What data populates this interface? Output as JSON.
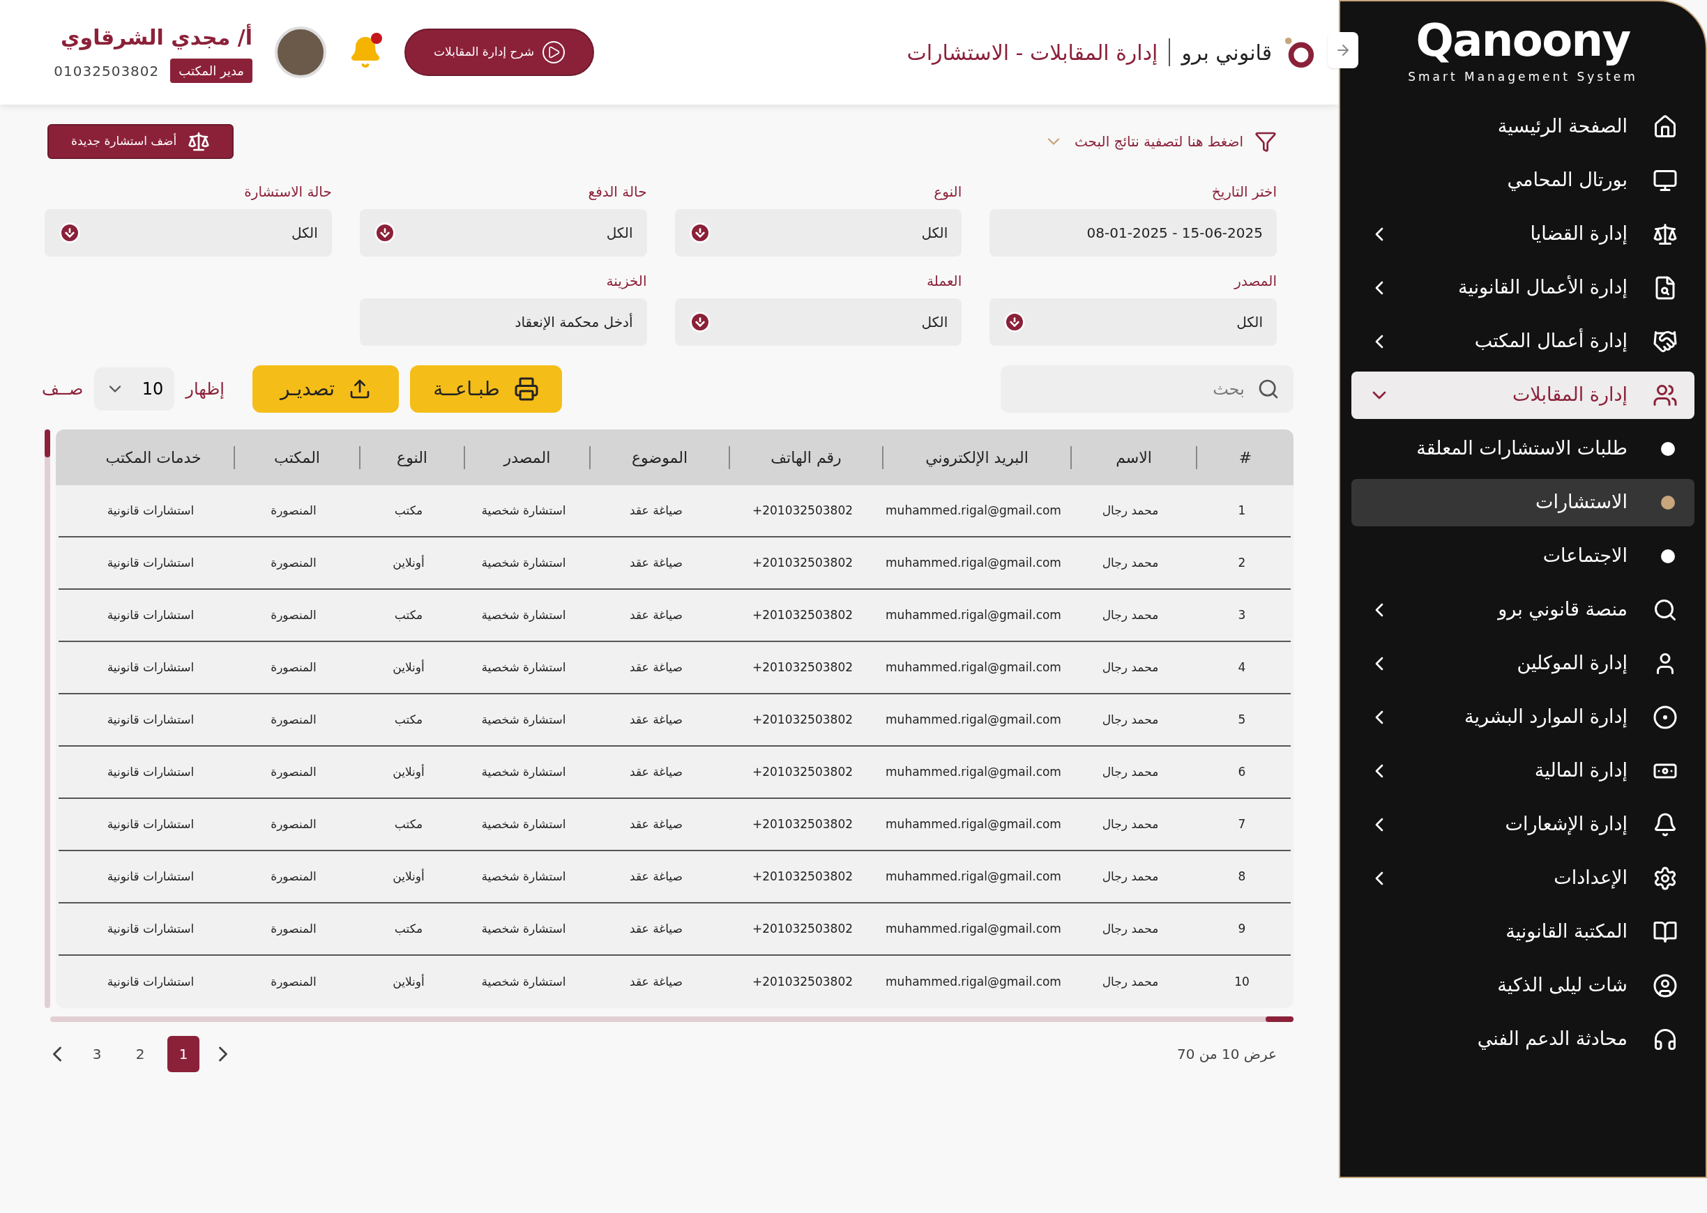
{
  "header": {
    "brand": "قانوني برو",
    "title": "إدارة المقابلات - الاستشارات",
    "guide_button": "شرح إدارة المقابلات",
    "notifications": {
      "unread": true
    },
    "user": {
      "name": "أ/ مجدي الشرقاوي",
      "role": "مدير المكتب",
      "phone": "01032503802"
    }
  },
  "filter_toggle": {
    "label": "اضغط هنا لتصفية نتائج البحث",
    "expanded": false
  },
  "add_button": "أضف استشارة جديدة",
  "filters": [
    {
      "kind": "date",
      "label": "اختر التاريخ",
      "value": "08-01-2025 - 15-06-2025"
    },
    {
      "kind": "select",
      "label": "النوع",
      "value": "الكل"
    },
    {
      "kind": "select",
      "label": "حالة الدفع",
      "value": "الكل"
    },
    {
      "kind": "select",
      "label": "حالة الاستشارة",
      "value": "الكل"
    },
    {
      "kind": "select",
      "label": "المصدر",
      "value": "الكل"
    },
    {
      "kind": "select",
      "label": "العملة",
      "value": "الكل"
    },
    {
      "kind": "text",
      "label": "الخزينة",
      "value": "أدخل محكمة الإنعقاد"
    }
  ],
  "toolbar": {
    "search_placeholder": "بحث",
    "print": "طبـاعــة",
    "export": "تصديـر",
    "show_label": "إظهار",
    "page_size": "10",
    "rows_label": "صــف"
  },
  "table": {
    "columns": [
      "#",
      "الاسم",
      "البريد الإلكتروني",
      "رقم الهاتف",
      "الموضوع",
      "المصدر",
      "النوع",
      "المكتب",
      "خدمات المكتب"
    ],
    "rows": [
      [
        "1",
        "محمد رجال",
        "muhammed.rigal@gmail.com",
        "+201032503802",
        "صياغة عقد",
        "استشارة شخصية",
        "مكتب",
        "المنصورة",
        "استشارات قانونية"
      ],
      [
        "2",
        "محمد رجال",
        "muhammed.rigal@gmail.com",
        "+201032503802",
        "صياغة عقد",
        "استشارة شخصية",
        "أونلاين",
        "المنصورة",
        "استشارات قانونية"
      ],
      [
        "3",
        "محمد رجال",
        "muhammed.rigal@gmail.com",
        "+201032503802",
        "صياغة عقد",
        "استشارة شخصية",
        "مكتب",
        "المنصورة",
        "استشارات قانونية"
      ],
      [
        "4",
        "محمد رجال",
        "muhammed.rigal@gmail.com",
        "+201032503802",
        "صياغة عقد",
        "استشارة شخصية",
        "أونلاين",
        "المنصورة",
        "استشارات قانونية"
      ],
      [
        "5",
        "محمد رجال",
        "muhammed.rigal@gmail.com",
        "+201032503802",
        "صياغة عقد",
        "استشارة شخصية",
        "مكتب",
        "المنصورة",
        "استشارات قانونية"
      ],
      [
        "6",
        "محمد رجال",
        "muhammed.rigal@gmail.com",
        "+201032503802",
        "صياغة عقد",
        "استشارة شخصية",
        "أونلاين",
        "المنصورة",
        "استشارات قانونية"
      ],
      [
        "7",
        "محمد رجال",
        "muhammed.rigal@gmail.com",
        "+201032503802",
        "صياغة عقد",
        "استشارة شخصية",
        "مكتب",
        "المنصورة",
        "استشارات قانونية"
      ],
      [
        "8",
        "محمد رجال",
        "muhammed.rigal@gmail.com",
        "+201032503802",
        "صياغة عقد",
        "استشارة شخصية",
        "أونلاين",
        "المنصورة",
        "استشارات قانونية"
      ],
      [
        "9",
        "محمد رجال",
        "muhammed.rigal@gmail.com",
        "+201032503802",
        "صياغة عقد",
        "استشارة شخصية",
        "مكتب",
        "المنصورة",
        "استشارات قانونية"
      ],
      [
        "10",
        "محمد رجال",
        "muhammed.rigal@gmail.com",
        "+201032503802",
        "صياغة عقد",
        "استشارة شخصية",
        "أونلاين",
        "المنصورة",
        "استشارات قانونية"
      ]
    ]
  },
  "pagination": {
    "summary": "عرض 10 من 70",
    "pages": [
      {
        "label": "1",
        "selected": true
      },
      {
        "label": "2",
        "selected": false
      },
      {
        "label": "3",
        "selected": false
      }
    ]
  },
  "sidebar": {
    "logo": "Qanoony",
    "tagline": "Smart Management System",
    "items": [
      {
        "label": "الصفحة الرئيسية",
        "has_submenu": false,
        "selected": false
      },
      {
        "label": "بورتال المحامي",
        "has_submenu": false,
        "selected": false
      },
      {
        "label": "إدارة القضايا",
        "has_submenu": true,
        "selected": false,
        "expanded": false
      },
      {
        "label": "إدارة الأعمال القانونية",
        "has_submenu": true,
        "selected": false,
        "expanded": false
      },
      {
        "label": "إدارة أعمال المكتب",
        "has_submenu": true,
        "selected": false,
        "expanded": false
      },
      {
        "label": "إدارة المقابلات",
        "has_submenu": true,
        "selected": true,
        "expanded": true,
        "children": [
          {
            "label": "طلبات الاستشارات المعلقة",
            "selected": false
          },
          {
            "label": "الاستشارات",
            "selected": true
          },
          {
            "label": "الاجتماعات",
            "selected": false
          }
        ]
      },
      {
        "label": "منصة قانوني برو",
        "has_submenu": true,
        "selected": false,
        "expanded": false
      },
      {
        "label": "إدارة الموكلين",
        "has_submenu": true,
        "selected": false,
        "expanded": false
      },
      {
        "label": "إدارة الموارد البشرية",
        "has_submenu": true,
        "selected": false,
        "expanded": false
      },
      {
        "label": "إدارة المالية",
        "has_submenu": true,
        "selected": false,
        "expanded": false
      },
      {
        "label": "إدارة الإشعارات",
        "has_submenu": true,
        "selected": false,
        "expanded": false
      },
      {
        "label": "الإعدادات",
        "has_submenu": true,
        "selected": false,
        "expanded": false
      },
      {
        "label": "المكتبة القانونية",
        "has_submenu": false,
        "selected": false
      },
      {
        "label": "شات ليلى الذكية",
        "has_submenu": false,
        "selected": false
      },
      {
        "label": "محادثة الدعم الفني",
        "has_submenu": false,
        "selected": false
      }
    ]
  }
}
